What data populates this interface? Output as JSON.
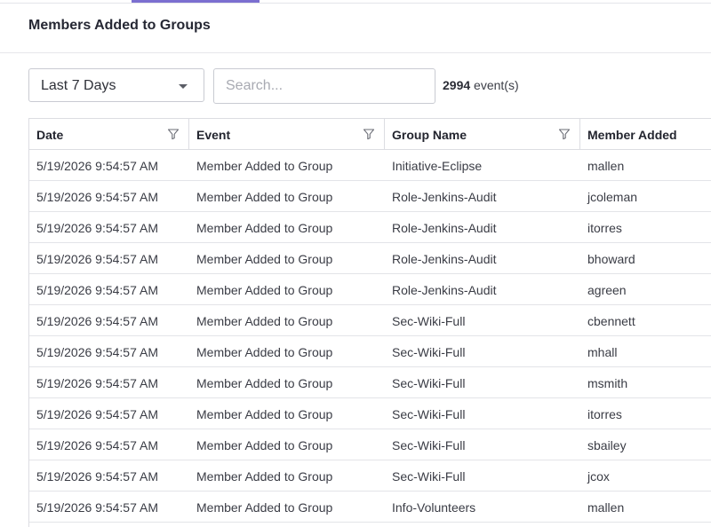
{
  "panel": {
    "title": "Members Added to Groups"
  },
  "toolbar": {
    "range_value": "Last 7 Days",
    "search_placeholder": "Search...",
    "event_count": "2994",
    "event_count_suffix": " event(s)"
  },
  "table": {
    "columns": [
      "Date",
      "Event",
      "Group Name",
      "Member Added"
    ],
    "filter_icon": "funnel-icon",
    "rows": [
      [
        "5/19/2026 9:54:57 AM",
        "Member Added to Group",
        "Initiative-Eclipse",
        "mallen"
      ],
      [
        "5/19/2026 9:54:57 AM",
        "Member Added to Group",
        "Role-Jenkins-Audit",
        "jcoleman"
      ],
      [
        "5/19/2026 9:54:57 AM",
        "Member Added to Group",
        "Role-Jenkins-Audit",
        "itorres"
      ],
      [
        "5/19/2026 9:54:57 AM",
        "Member Added to Group",
        "Role-Jenkins-Audit",
        "bhoward"
      ],
      [
        "5/19/2026 9:54:57 AM",
        "Member Added to Group",
        "Role-Jenkins-Audit",
        "agreen"
      ],
      [
        "5/19/2026 9:54:57 AM",
        "Member Added to Group",
        "Sec-Wiki-Full",
        "cbennett"
      ],
      [
        "5/19/2026 9:54:57 AM",
        "Member Added to Group",
        "Sec-Wiki-Full",
        "mhall"
      ],
      [
        "5/19/2026 9:54:57 AM",
        "Member Added to Group",
        "Sec-Wiki-Full",
        "msmith"
      ],
      [
        "5/19/2026 9:54:57 AM",
        "Member Added to Group",
        "Sec-Wiki-Full",
        "itorres"
      ],
      [
        "5/19/2026 9:54:57 AM",
        "Member Added to Group",
        "Sec-Wiki-Full",
        "sbailey"
      ],
      [
        "5/19/2026 9:54:57 AM",
        "Member Added to Group",
        "Sec-Wiki-Full",
        "jcox"
      ],
      [
        "5/19/2026 9:54:57 AM",
        "Member Added to Group",
        "Info-Volunteers",
        "mallen"
      ]
    ]
  },
  "colors": {
    "accent": "#7b6fd0",
    "border": "#dcdde2"
  }
}
